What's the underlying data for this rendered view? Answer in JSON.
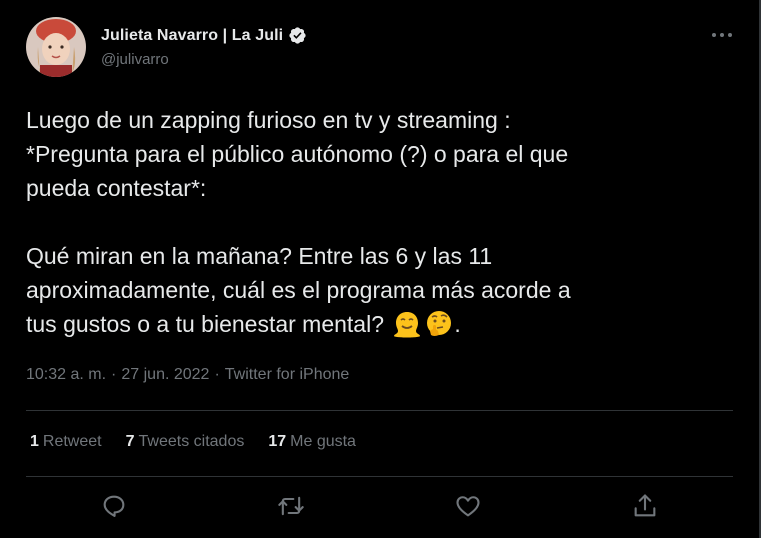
{
  "author": {
    "name": "Julieta Navarro | La Juli",
    "handle": "@julivarro",
    "verified": true
  },
  "tweet": {
    "lines_p1": [
      "Luego de un zapping furioso en tv y streaming :",
      "*Pregunta para el público autónomo (?) o para el que",
      "pueda contestar*:"
    ],
    "lines_p2": [
      "Qué miran en la mañana? Entre las 6 y las 11",
      "aproximadamente, cuál es el programa más acorde a"
    ],
    "last_line": "tus gustos o a tu bienestar mental?",
    "trailing": ".",
    "emojis": [
      "melting-face-emoji",
      "thinking-face-emoji"
    ]
  },
  "meta": {
    "time": "10:32 a. m.",
    "sep1": "·",
    "date": "27 jun. 2022",
    "sep2": "·",
    "source": "Twitter for iPhone"
  },
  "stats": {
    "retweets": {
      "count": "1",
      "label": "Retweet"
    },
    "quotes": {
      "count": "7",
      "label": "Tweets citados"
    },
    "likes": {
      "count": "17",
      "label": "Me gusta"
    }
  },
  "icons": {
    "more": "more-horizontal-icon",
    "reply": "reply-icon",
    "retweet": "retweet-icon",
    "like": "heart-icon",
    "share": "share-icon",
    "verified": "verified-badge-icon"
  },
  "colors": {
    "background": "#000000",
    "text": "#e7e9ea",
    "muted": "#71767b",
    "divider": "#2f3336"
  }
}
